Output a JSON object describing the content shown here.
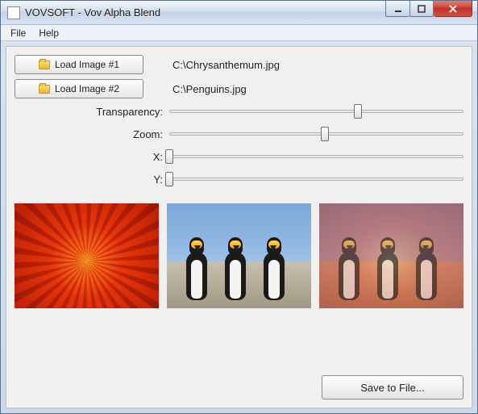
{
  "window": {
    "title": "VOVSOFT - Vov Alpha Blend"
  },
  "menubar": {
    "items": [
      "File",
      "Help"
    ]
  },
  "controls": {
    "load1_label": "Load Image #1",
    "load2_label": "Load Image #2",
    "path1": "C:\\Chrysanthemum.jpg",
    "path2": "C:\\Penguins.jpg",
    "sliders": {
      "transparency": {
        "label": "Transparency:",
        "position_pct": 64
      },
      "zoom": {
        "label": "Zoom:",
        "position_pct": 53
      },
      "x": {
        "label": "X:",
        "position_pct": 0
      },
      "y": {
        "label": "Y:",
        "position_pct": 0
      }
    },
    "save_label": "Save to File..."
  }
}
